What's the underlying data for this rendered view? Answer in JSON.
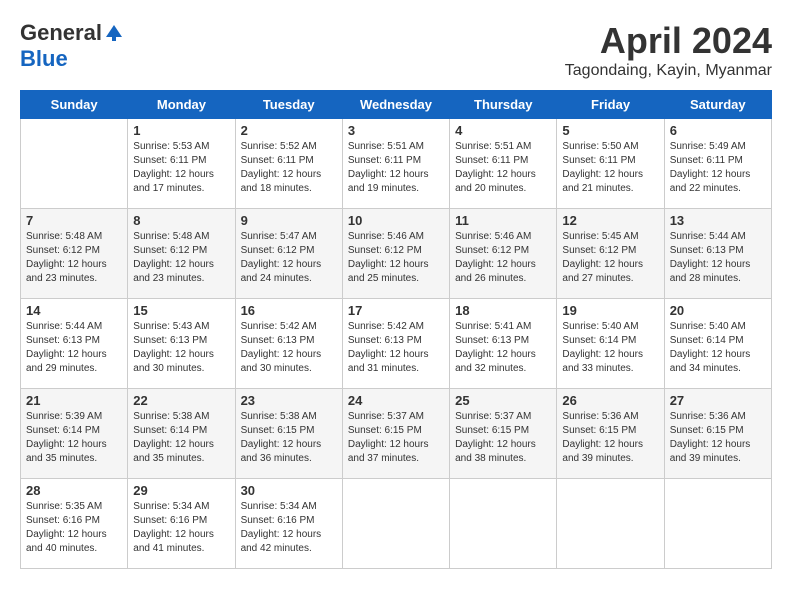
{
  "header": {
    "logo_general": "General",
    "logo_blue": "Blue",
    "month_title": "April 2024",
    "location": "Tagondaing, Kayin, Myanmar"
  },
  "days_of_week": [
    "Sunday",
    "Monday",
    "Tuesday",
    "Wednesday",
    "Thursday",
    "Friday",
    "Saturday"
  ],
  "weeks": [
    [
      {
        "day": "",
        "sunrise": "",
        "sunset": "",
        "daylight": "",
        "empty": true
      },
      {
        "day": "1",
        "sunrise": "Sunrise: 5:53 AM",
        "sunset": "Sunset: 6:11 PM",
        "daylight": "Daylight: 12 hours and 17 minutes."
      },
      {
        "day": "2",
        "sunrise": "Sunrise: 5:52 AM",
        "sunset": "Sunset: 6:11 PM",
        "daylight": "Daylight: 12 hours and 18 minutes."
      },
      {
        "day": "3",
        "sunrise": "Sunrise: 5:51 AM",
        "sunset": "Sunset: 6:11 PM",
        "daylight": "Daylight: 12 hours and 19 minutes."
      },
      {
        "day": "4",
        "sunrise": "Sunrise: 5:51 AM",
        "sunset": "Sunset: 6:11 PM",
        "daylight": "Daylight: 12 hours and 20 minutes."
      },
      {
        "day": "5",
        "sunrise": "Sunrise: 5:50 AM",
        "sunset": "Sunset: 6:11 PM",
        "daylight": "Daylight: 12 hours and 21 minutes."
      },
      {
        "day": "6",
        "sunrise": "Sunrise: 5:49 AM",
        "sunset": "Sunset: 6:11 PM",
        "daylight": "Daylight: 12 hours and 22 minutes."
      }
    ],
    [
      {
        "day": "7",
        "sunrise": "Sunrise: 5:48 AM",
        "sunset": "Sunset: 6:12 PM",
        "daylight": "Daylight: 12 hours and 23 minutes."
      },
      {
        "day": "8",
        "sunrise": "Sunrise: 5:48 AM",
        "sunset": "Sunset: 6:12 PM",
        "daylight": "Daylight: 12 hours and 23 minutes."
      },
      {
        "day": "9",
        "sunrise": "Sunrise: 5:47 AM",
        "sunset": "Sunset: 6:12 PM",
        "daylight": "Daylight: 12 hours and 24 minutes."
      },
      {
        "day": "10",
        "sunrise": "Sunrise: 5:46 AM",
        "sunset": "Sunset: 6:12 PM",
        "daylight": "Daylight: 12 hours and 25 minutes."
      },
      {
        "day": "11",
        "sunrise": "Sunrise: 5:46 AM",
        "sunset": "Sunset: 6:12 PM",
        "daylight": "Daylight: 12 hours and 26 minutes."
      },
      {
        "day": "12",
        "sunrise": "Sunrise: 5:45 AM",
        "sunset": "Sunset: 6:12 PM",
        "daylight": "Daylight: 12 hours and 27 minutes."
      },
      {
        "day": "13",
        "sunrise": "Sunrise: 5:44 AM",
        "sunset": "Sunset: 6:13 PM",
        "daylight": "Daylight: 12 hours and 28 minutes."
      }
    ],
    [
      {
        "day": "14",
        "sunrise": "Sunrise: 5:44 AM",
        "sunset": "Sunset: 6:13 PM",
        "daylight": "Daylight: 12 hours and 29 minutes."
      },
      {
        "day": "15",
        "sunrise": "Sunrise: 5:43 AM",
        "sunset": "Sunset: 6:13 PM",
        "daylight": "Daylight: 12 hours and 30 minutes."
      },
      {
        "day": "16",
        "sunrise": "Sunrise: 5:42 AM",
        "sunset": "Sunset: 6:13 PM",
        "daylight": "Daylight: 12 hours and 30 minutes."
      },
      {
        "day": "17",
        "sunrise": "Sunrise: 5:42 AM",
        "sunset": "Sunset: 6:13 PM",
        "daylight": "Daylight: 12 hours and 31 minutes."
      },
      {
        "day": "18",
        "sunrise": "Sunrise: 5:41 AM",
        "sunset": "Sunset: 6:13 PM",
        "daylight": "Daylight: 12 hours and 32 minutes."
      },
      {
        "day": "19",
        "sunrise": "Sunrise: 5:40 AM",
        "sunset": "Sunset: 6:14 PM",
        "daylight": "Daylight: 12 hours and 33 minutes."
      },
      {
        "day": "20",
        "sunrise": "Sunrise: 5:40 AM",
        "sunset": "Sunset: 6:14 PM",
        "daylight": "Daylight: 12 hours and 34 minutes."
      }
    ],
    [
      {
        "day": "21",
        "sunrise": "Sunrise: 5:39 AM",
        "sunset": "Sunset: 6:14 PM",
        "daylight": "Daylight: 12 hours and 35 minutes."
      },
      {
        "day": "22",
        "sunrise": "Sunrise: 5:38 AM",
        "sunset": "Sunset: 6:14 PM",
        "daylight": "Daylight: 12 hours and 35 minutes."
      },
      {
        "day": "23",
        "sunrise": "Sunrise: 5:38 AM",
        "sunset": "Sunset: 6:15 PM",
        "daylight": "Daylight: 12 hours and 36 minutes."
      },
      {
        "day": "24",
        "sunrise": "Sunrise: 5:37 AM",
        "sunset": "Sunset: 6:15 PM",
        "daylight": "Daylight: 12 hours and 37 minutes."
      },
      {
        "day": "25",
        "sunrise": "Sunrise: 5:37 AM",
        "sunset": "Sunset: 6:15 PM",
        "daylight": "Daylight: 12 hours and 38 minutes."
      },
      {
        "day": "26",
        "sunrise": "Sunrise: 5:36 AM",
        "sunset": "Sunset: 6:15 PM",
        "daylight": "Daylight: 12 hours and 39 minutes."
      },
      {
        "day": "27",
        "sunrise": "Sunrise: 5:36 AM",
        "sunset": "Sunset: 6:15 PM",
        "daylight": "Daylight: 12 hours and 39 minutes."
      }
    ],
    [
      {
        "day": "28",
        "sunrise": "Sunrise: 5:35 AM",
        "sunset": "Sunset: 6:16 PM",
        "daylight": "Daylight: 12 hours and 40 minutes."
      },
      {
        "day": "29",
        "sunrise": "Sunrise: 5:34 AM",
        "sunset": "Sunset: 6:16 PM",
        "daylight": "Daylight: 12 hours and 41 minutes."
      },
      {
        "day": "30",
        "sunrise": "Sunrise: 5:34 AM",
        "sunset": "Sunset: 6:16 PM",
        "daylight": "Daylight: 12 hours and 42 minutes."
      },
      {
        "day": "",
        "sunrise": "",
        "sunset": "",
        "daylight": "",
        "empty": true
      },
      {
        "day": "",
        "sunrise": "",
        "sunset": "",
        "daylight": "",
        "empty": true
      },
      {
        "day": "",
        "sunrise": "",
        "sunset": "",
        "daylight": "",
        "empty": true
      },
      {
        "day": "",
        "sunrise": "",
        "sunset": "",
        "daylight": "",
        "empty": true
      }
    ]
  ]
}
